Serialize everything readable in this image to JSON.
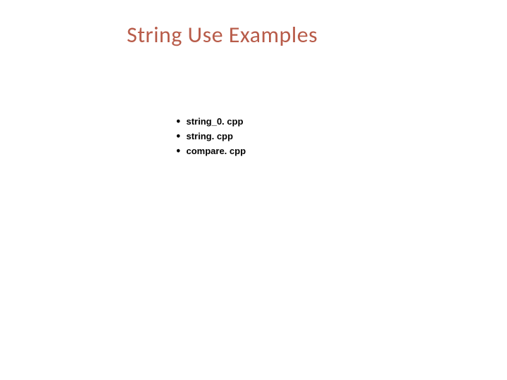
{
  "title": "String Use Examples",
  "items": [
    {
      "text": "string_0. cpp"
    },
    {
      "text": "string. cpp"
    },
    {
      "text": "compare. cpp"
    }
  ]
}
